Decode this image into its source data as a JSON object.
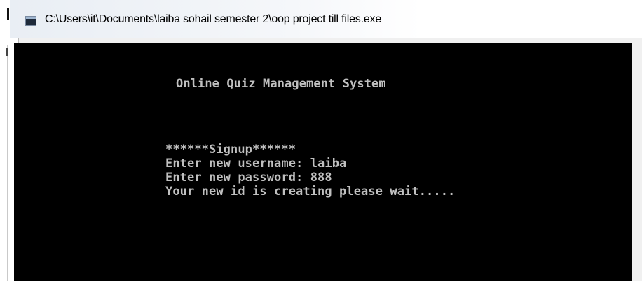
{
  "window": {
    "title": "C:\\Users\\it\\Documents\\laiba sohail semester 2\\oop project till files.exe",
    "icon": "console-app-icon"
  },
  "console": {
    "heading": "Online Quiz Management System",
    "signup_banner": "******Signup******",
    "username_line": "Enter new username: laiba",
    "password_line": "Enter new password: 888",
    "status_line": "Your new id is creating please wait....."
  },
  "colors": {
    "console_background": "#000000",
    "console_text": "#c0c0c0"
  }
}
